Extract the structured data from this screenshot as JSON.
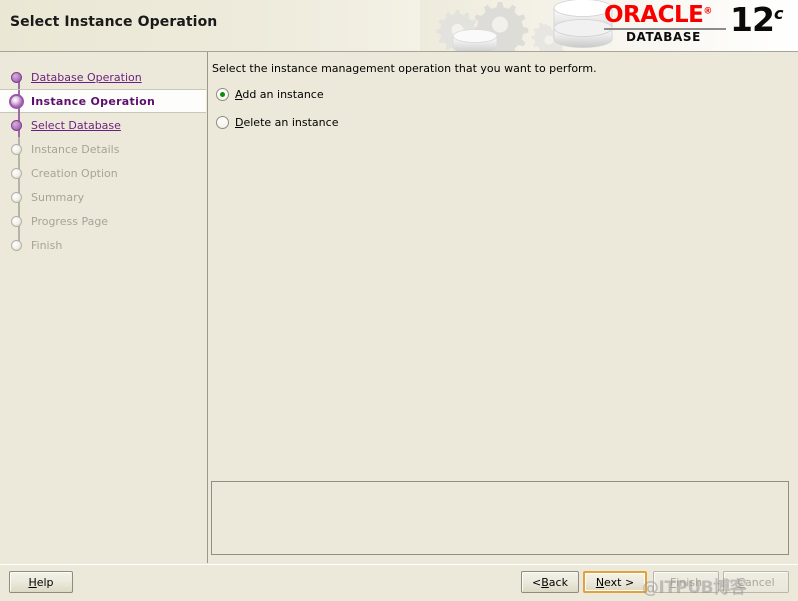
{
  "header": {
    "title": "Select Instance Operation",
    "logo": {
      "brand": "ORACLE",
      "registered": "®",
      "product": "DATABASE",
      "version": "12",
      "version_suffix": "c",
      "brand_color": "#f80000"
    }
  },
  "sidebar": {
    "steps": [
      {
        "label": "Database Operation",
        "state": "done"
      },
      {
        "label": "Instance Operation",
        "state": "current"
      },
      {
        "label": "Select Database",
        "state": "done"
      },
      {
        "label": "Instance Details",
        "state": "disabled"
      },
      {
        "label": "Creation Option",
        "state": "disabled"
      },
      {
        "label": "Summary",
        "state": "disabled"
      },
      {
        "label": "Progress Page",
        "state": "disabled"
      },
      {
        "label": "Finish",
        "state": "disabled"
      }
    ]
  },
  "main": {
    "instruction": "Select the instance management operation that you want to perform.",
    "options": [
      {
        "label_mnemonic": "A",
        "label_rest": "dd an instance",
        "selected": true
      },
      {
        "label_mnemonic": "D",
        "label_rest": "elete an instance",
        "selected": false
      }
    ],
    "message_panel_text": ""
  },
  "footer": {
    "help": {
      "mnemonic": "H",
      "rest": "elp",
      "enabled": true
    },
    "back": {
      "prefix": "< ",
      "mnemonic": "B",
      "rest": "ack",
      "enabled": true
    },
    "next": {
      "mnemonic": "N",
      "rest": "ext >",
      "enabled": true,
      "focused": true
    },
    "finish": {
      "mnemonic": "F",
      "rest": "inish",
      "enabled": false
    },
    "cancel": {
      "mnemonic": "C",
      "rest": "ancel",
      "enabled": false
    }
  },
  "watermark": {
    "text": "@ITPUB博客"
  }
}
